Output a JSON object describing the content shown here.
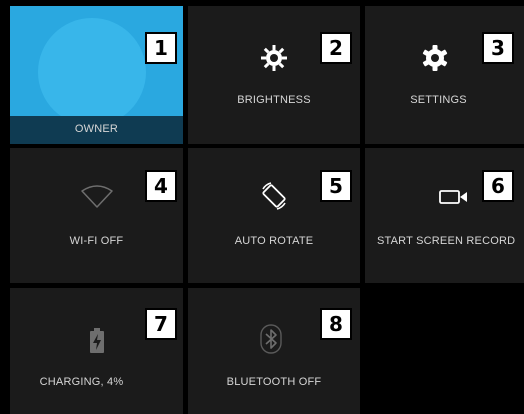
{
  "tiles": [
    {
      "number": "1",
      "label": "OWNER"
    },
    {
      "number": "2",
      "label": "BRIGHTNESS",
      "icon": "brightness-icon"
    },
    {
      "number": "3",
      "label": "SETTINGS",
      "icon": "settings-gear-icon"
    },
    {
      "number": "4",
      "label": "WI-FI OFF",
      "icon": "wifi-off-icon"
    },
    {
      "number": "5",
      "label": "AUTO ROTATE",
      "icon": "auto-rotate-icon"
    },
    {
      "number": "6",
      "label": "START SCREEN RECORD",
      "icon": "screen-record-icon"
    },
    {
      "number": "7",
      "label": "CHARGING, 4%",
      "icon": "battery-charging-icon"
    },
    {
      "number": "8",
      "label": "BLUETOOTH OFF",
      "icon": "bluetooth-off-icon"
    }
  ],
  "colors": {
    "tile_bg": "#1b1b1b",
    "owner_accent": "#2aa8e0",
    "owner_strip": "#0f3b52",
    "label_text": "#d6d6d6",
    "icon_active": "#ffffff",
    "icon_inactive": "#6e6e6e"
  }
}
